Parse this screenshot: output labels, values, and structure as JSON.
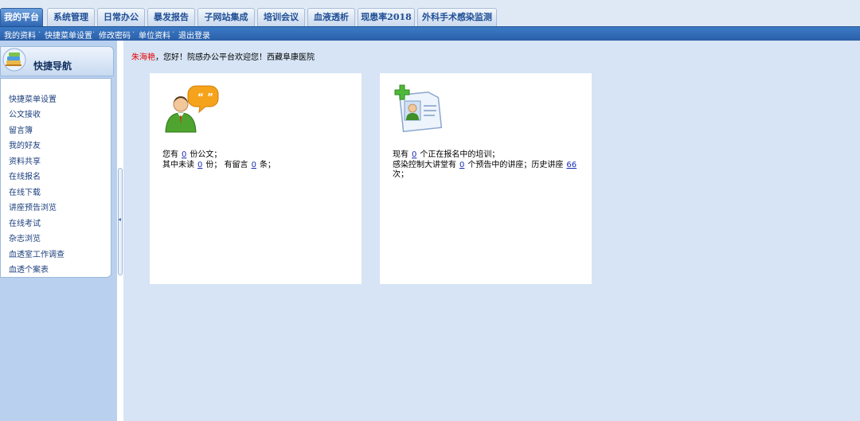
{
  "tabs": [
    {
      "label": "我的平台",
      "active": true
    },
    {
      "label": "系统管理",
      "active": false
    },
    {
      "label": "日常办公",
      "active": false
    },
    {
      "label": "暴发报告",
      "active": false
    },
    {
      "label": "子网站集成",
      "active": false
    },
    {
      "label": "培训会议",
      "active": false
    },
    {
      "label": "血液透析",
      "active": false
    },
    {
      "label": "现患率2018",
      "active": false
    },
    {
      "label": "外科手术感染监测",
      "active": false
    }
  ],
  "submenu": [
    "我的资料",
    "快捷菜单设置",
    "修改密码",
    "单位资料",
    "退出登录"
  ],
  "submenu_separator": "·",
  "nav": {
    "title": "快捷导航",
    "items": [
      "快捷菜单设置",
      "公文接收",
      "留言簿",
      "我的好友",
      "资料共享",
      "在线报名",
      "在线下载",
      "讲座预告浏览",
      "在线考试",
      "杂志浏览",
      "血透室工作调查",
      "血透个案表"
    ]
  },
  "welcome": {
    "user": "朱海艳",
    "text": "，您好！院感办公平台欢迎您！西藏阜康医院"
  },
  "card_docs": {
    "l1_a": "您有",
    "l1_n": "0",
    "l1_b": "份公文；",
    "l2_a": "其中未读",
    "l2_n1": "0",
    "l2_b": "份；  有留言",
    "l2_n2": "0",
    "l2_c": "条；"
  },
  "card_training": {
    "l1_a": "现有",
    "l1_n": "0",
    "l1_b": "个正在报名中的培训；",
    "l2_a": "感染控制大讲堂有",
    "l2_n1": "0",
    "l2_b": "个预告中的讲座；历史讲座",
    "l2_n2": "66",
    "l3": "次；"
  },
  "colors": {
    "accent": "#2f67b4",
    "username": "#e60000",
    "link": "#1a2fb3"
  },
  "icons": {
    "nav_logo": "books-icon",
    "docs": "person-speech-icon",
    "training": "id-card-plus-icon"
  }
}
